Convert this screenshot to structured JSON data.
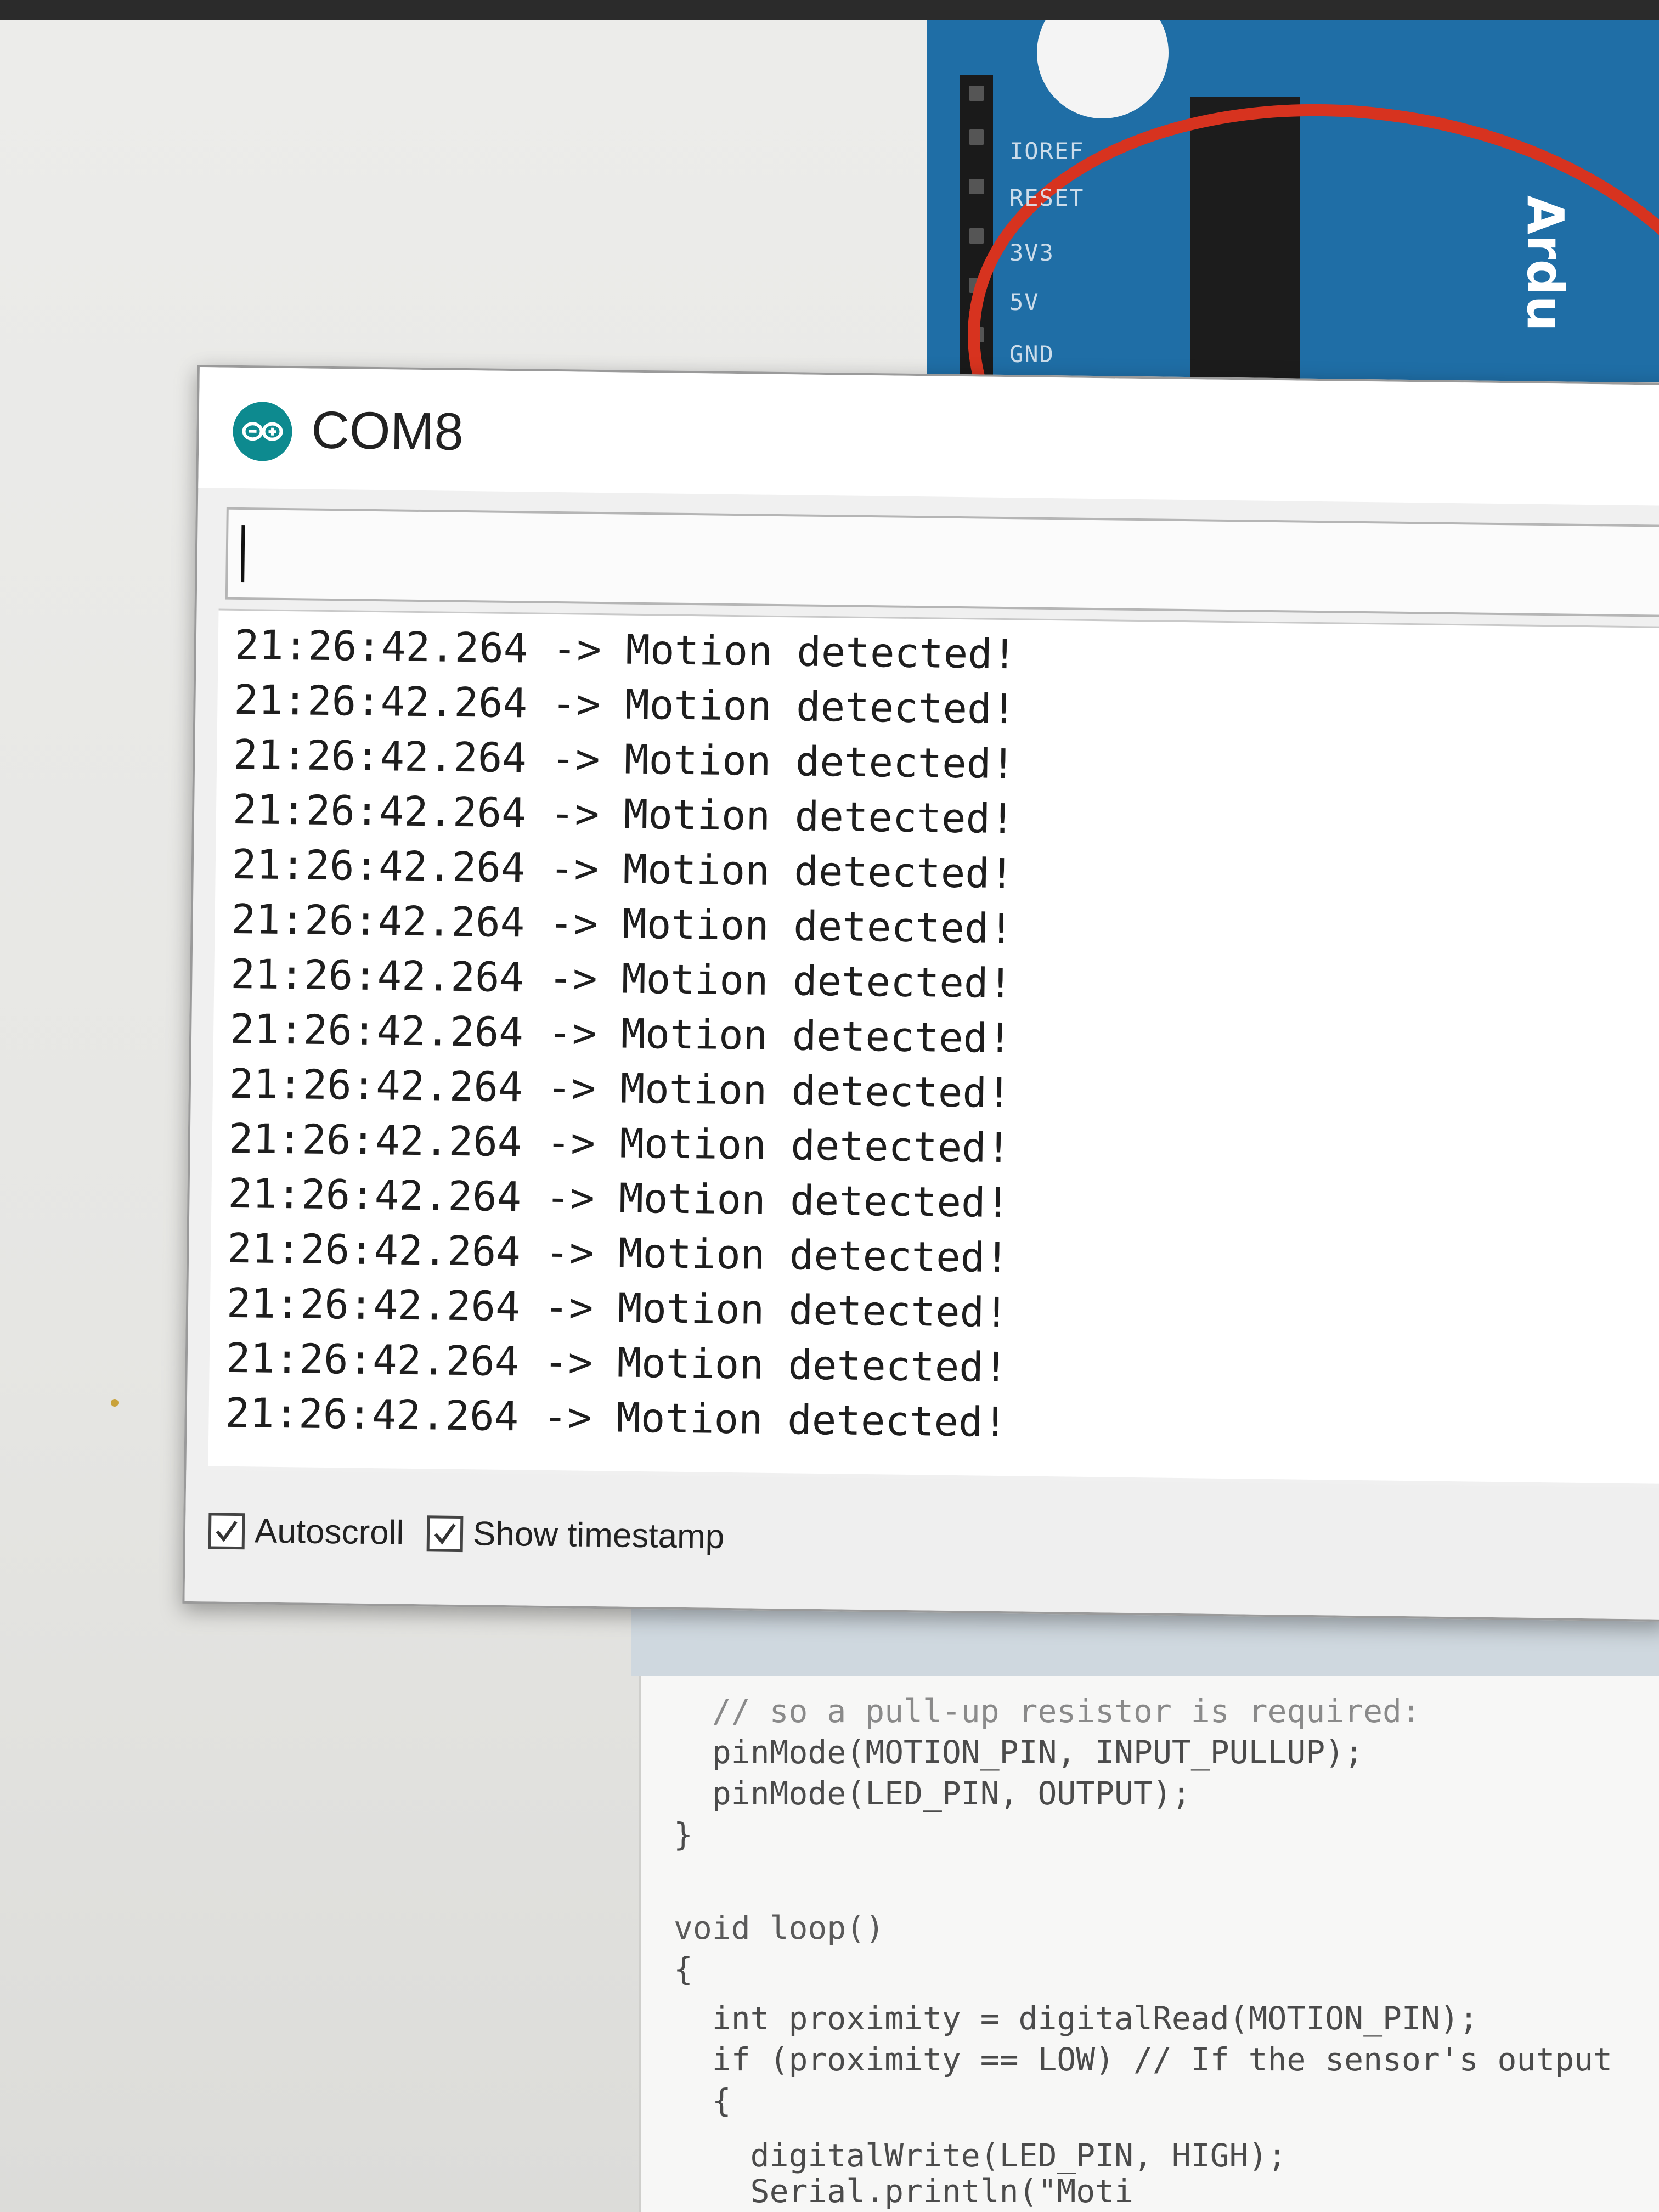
{
  "board": {
    "pin_labels": [
      "IOREF",
      "RESET",
      "3V3",
      "5V",
      "GND"
    ],
    "brand_text": "Ardu"
  },
  "window": {
    "title": "COM8",
    "input_value": ""
  },
  "output_lines": [
    "21:26:42.264 -> Motion detected!",
    "21:26:42.264 -> Motion detected!",
    "21:26:42.264 -> Motion detected!",
    "21:26:42.264 -> Motion detected!",
    "21:26:42.264 -> Motion detected!",
    "21:26:42.264 -> Motion detected!",
    "21:26:42.264 -> Motion detected!",
    "21:26:42.264 -> Motion detected!",
    "21:26:42.264 -> Motion detected!",
    "21:26:42.264 -> Motion detected!",
    "21:26:42.264 -> Motion detected!",
    "21:26:42.264 -> Motion detected!",
    "21:26:42.264 -> Motion detected!",
    "21:26:42.264 -> Motion detected!",
    "21:26:42.264 -> Motion detected!"
  ],
  "options": {
    "autoscroll_label": "Autoscroll",
    "autoscroll_checked": true,
    "timestamp_label": "Show timestamp",
    "timestamp_checked": true
  },
  "code_lines": [
    "  // so a pull-up resistor is required:",
    "  pinMode(MOTION_PIN, INPUT_PULLUP);",
    "  pinMode(LED_PIN, OUTPUT);",
    "}",
    "",
    "void loop()",
    "{",
    "  int proximity = digitalRead(MOTION_PIN);",
    "  if (proximity == LOW) // If the sensor's output",
    "  {",
    "    digitalWrite(LED_PIN, HIGH);",
    "    Serial.println(\"Moti"
  ],
  "colors": {
    "board_blue": "#1f6ea6",
    "wire_red": "#d7331f",
    "logo_teal": "#0d8a8f"
  }
}
